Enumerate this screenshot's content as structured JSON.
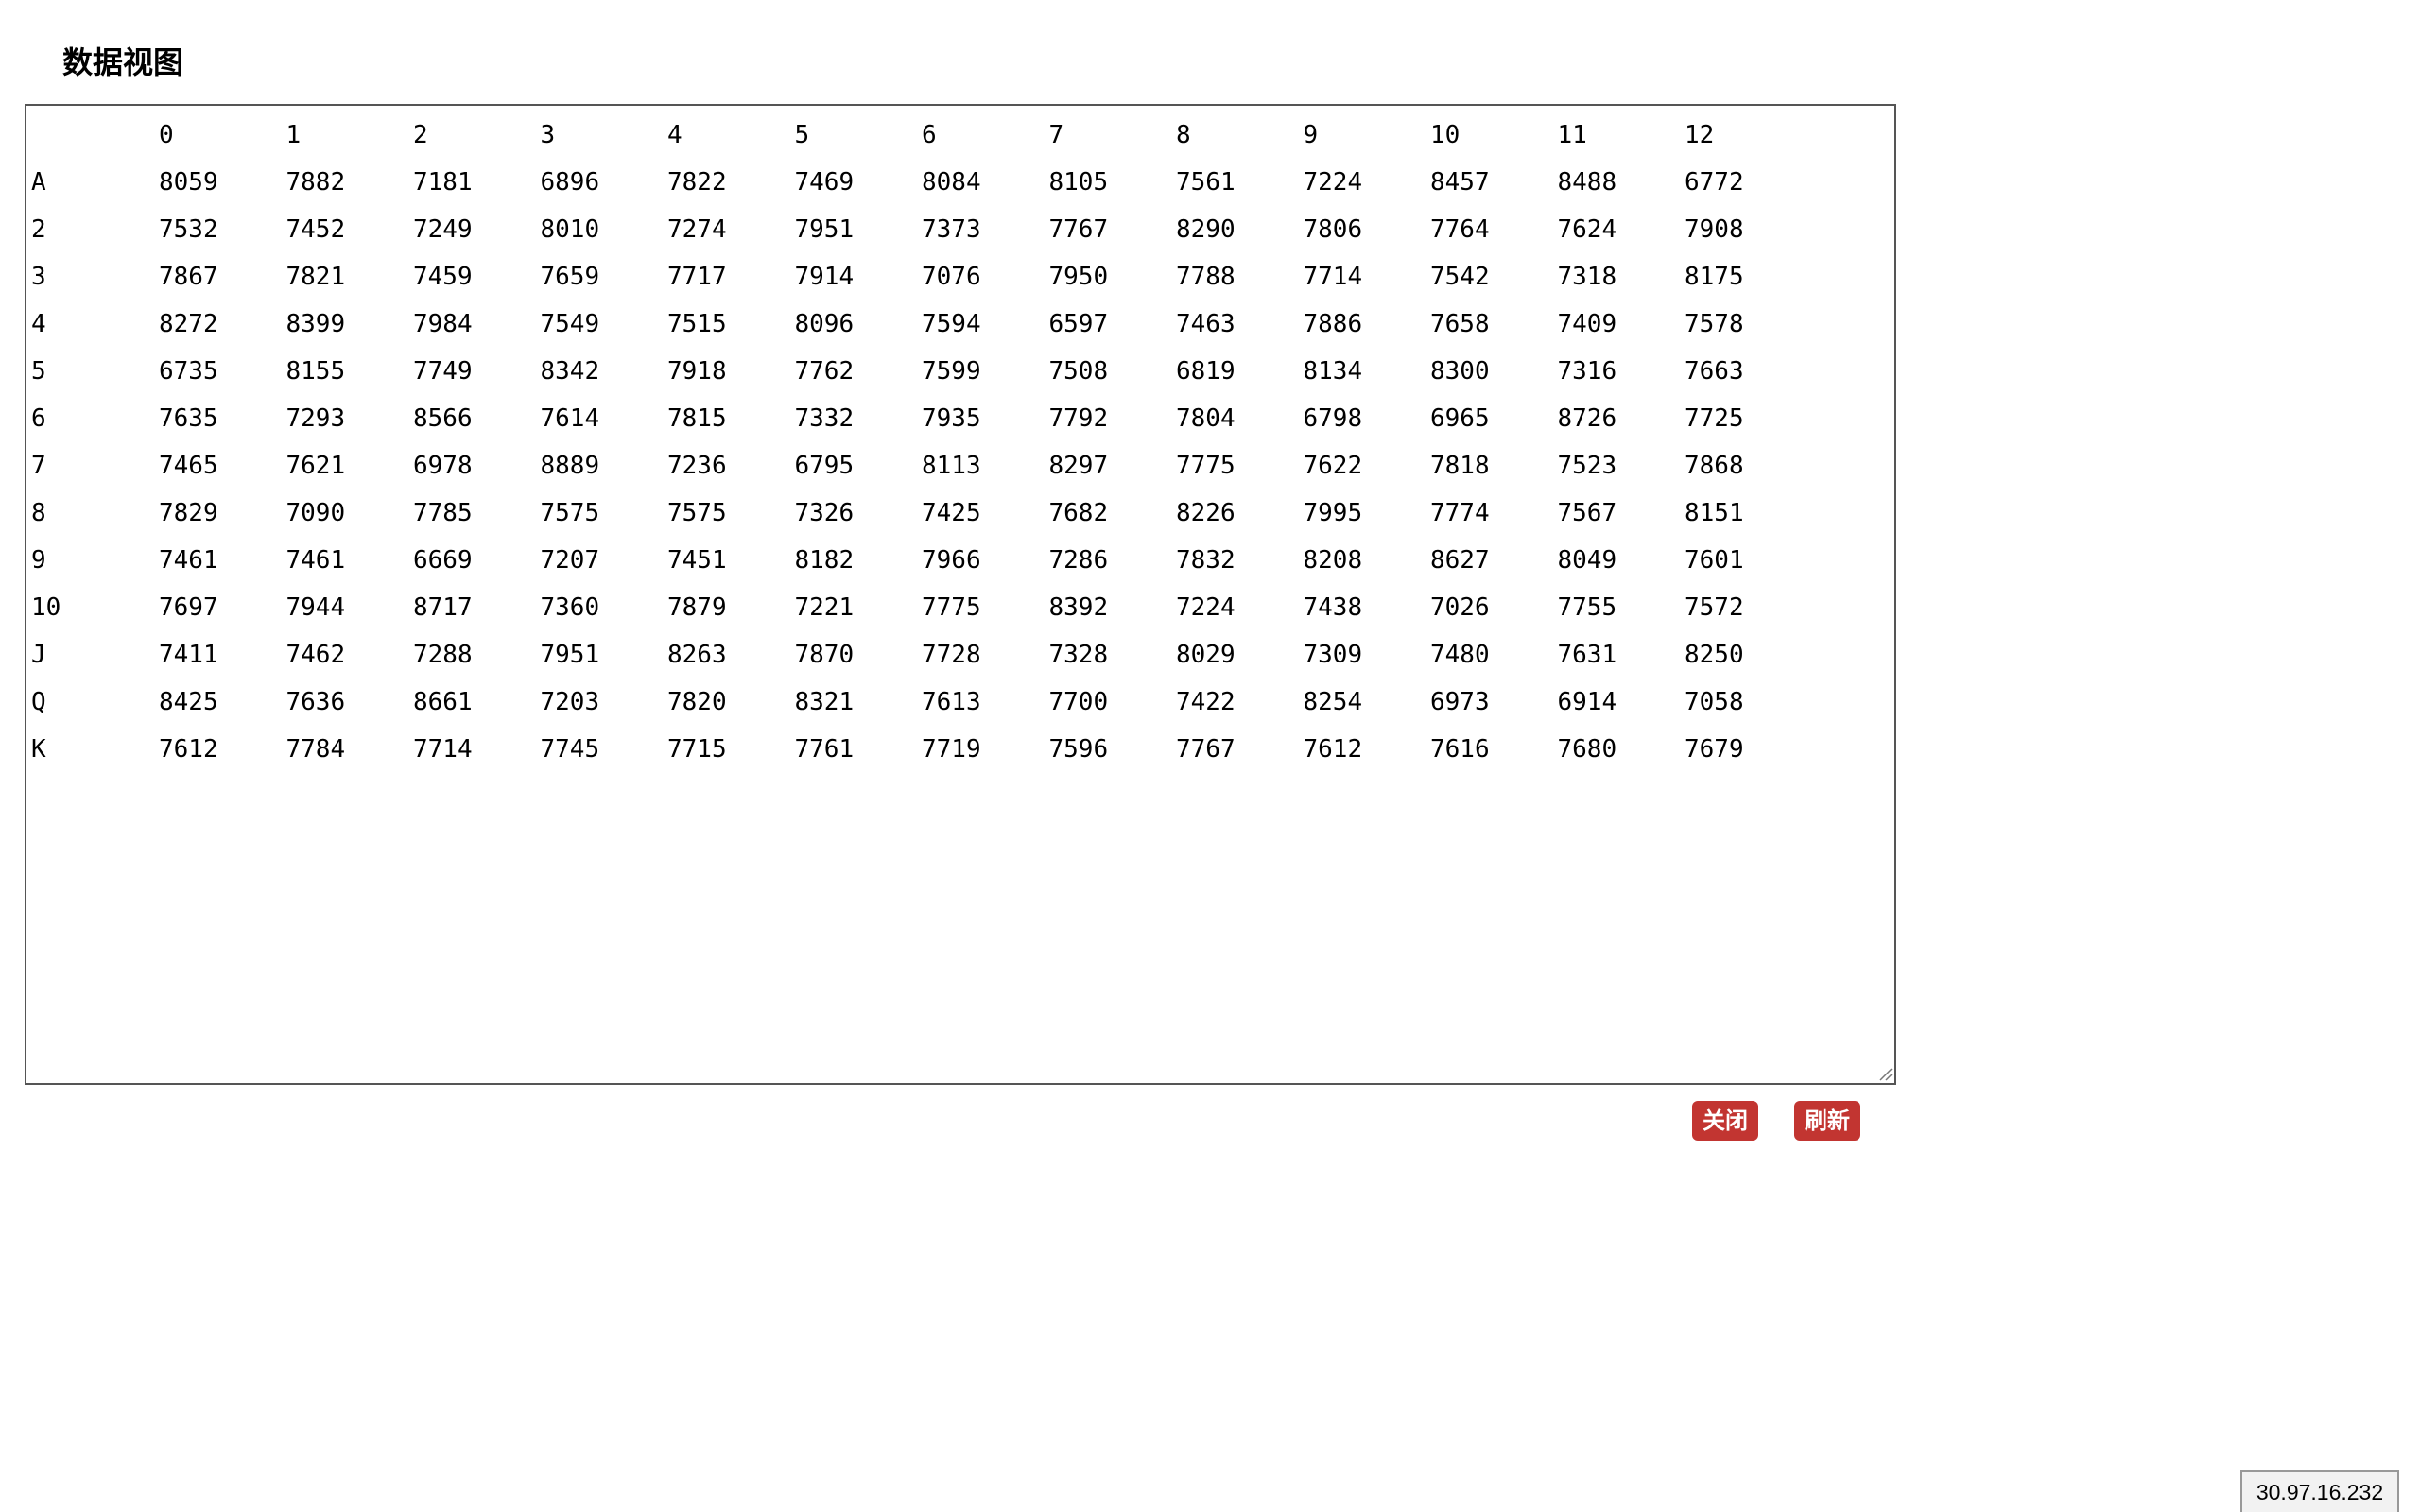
{
  "title": "数据视图",
  "buttons": {
    "close_label": "关闭",
    "refresh_label": "刷新"
  },
  "ip_address": "30.97.16.232",
  "colors": {
    "button_bg": "#c23531",
    "button_text": "#ffffff",
    "border": "#555555"
  },
  "table": {
    "columns": [
      "0",
      "1",
      "2",
      "3",
      "4",
      "5",
      "6",
      "7",
      "8",
      "9",
      "10",
      "11",
      "12"
    ],
    "rows": [
      {
        "label": "A",
        "values": [
          "8059",
          "7882",
          "7181",
          "6896",
          "7822",
          "7469",
          "8084",
          "8105",
          "7561",
          "7224",
          "8457",
          "8488",
          "6772"
        ]
      },
      {
        "label": "2",
        "values": [
          "7532",
          "7452",
          "7249",
          "8010",
          "7274",
          "7951",
          "7373",
          "7767",
          "8290",
          "7806",
          "7764",
          "7624",
          "7908"
        ]
      },
      {
        "label": "3",
        "values": [
          "7867",
          "7821",
          "7459",
          "7659",
          "7717",
          "7914",
          "7076",
          "7950",
          "7788",
          "7714",
          "7542",
          "7318",
          "8175"
        ]
      },
      {
        "label": "4",
        "values": [
          "8272",
          "8399",
          "7984",
          "7549",
          "7515",
          "8096",
          "7594",
          "6597",
          "7463",
          "7886",
          "7658",
          "7409",
          "7578"
        ]
      },
      {
        "label": "5",
        "values": [
          "6735",
          "8155",
          "7749",
          "8342",
          "7918",
          "7762",
          "7599",
          "7508",
          "6819",
          "8134",
          "8300",
          "7316",
          "7663"
        ]
      },
      {
        "label": "6",
        "values": [
          "7635",
          "7293",
          "8566",
          "7614",
          "7815",
          "7332",
          "7935",
          "7792",
          "7804",
          "6798",
          "6965",
          "8726",
          "7725"
        ]
      },
      {
        "label": "7",
        "values": [
          "7465",
          "7621",
          "6978",
          "8889",
          "7236",
          "6795",
          "8113",
          "8297",
          "7775",
          "7622",
          "7818",
          "7523",
          "7868"
        ]
      },
      {
        "label": "8",
        "values": [
          "7829",
          "7090",
          "7785",
          "7575",
          "7575",
          "7326",
          "7425",
          "7682",
          "8226",
          "7995",
          "7774",
          "7567",
          "8151"
        ]
      },
      {
        "label": "9",
        "values": [
          "7461",
          "7461",
          "6669",
          "7207",
          "7451",
          "8182",
          "7966",
          "7286",
          "7832",
          "8208",
          "8627",
          "8049",
          "7601"
        ]
      },
      {
        "label": "10",
        "values": [
          "7697",
          "7944",
          "8717",
          "7360",
          "7879",
          "7221",
          "7775",
          "8392",
          "7224",
          "7438",
          "7026",
          "7755",
          "7572"
        ]
      },
      {
        "label": "J",
        "values": [
          "7411",
          "7462",
          "7288",
          "7951",
          "8263",
          "7870",
          "7728",
          "7328",
          "8029",
          "7309",
          "7480",
          "7631",
          "8250"
        ]
      },
      {
        "label": "Q",
        "values": [
          "8425",
          "7636",
          "8661",
          "7203",
          "7820",
          "8321",
          "7613",
          "7700",
          "7422",
          "8254",
          "6973",
          "6914",
          "7058"
        ]
      },
      {
        "label": "K",
        "values": [
          "7612",
          "7784",
          "7714",
          "7745",
          "7715",
          "7761",
          "7719",
          "7596",
          "7767",
          "7612",
          "7616",
          "7680",
          "7679"
        ]
      }
    ]
  }
}
